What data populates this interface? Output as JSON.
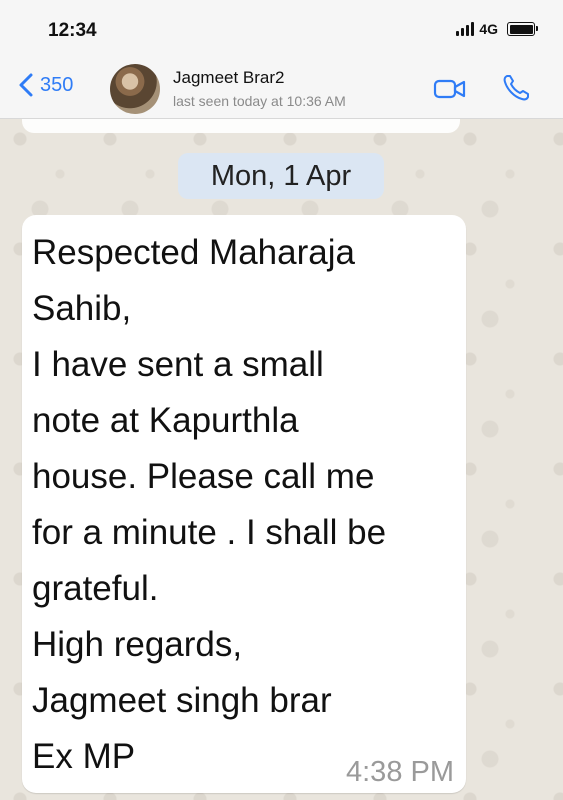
{
  "status_bar": {
    "time": "12:34",
    "network": "4G"
  },
  "header": {
    "back_count": "350",
    "contact_name": "Jagmeet Brar2",
    "last_seen": "last seen today at 10:36 AM"
  },
  "chat": {
    "date_label": "Mon, 1 Apr",
    "message": {
      "text": "Respected Maharaja\nSahib,\nI have sent a small\nnote at Kapurthla\nhouse. Please call me\nfor a minute . I shall be\ngrateful.\nHigh regards,\nJagmeet singh brar\nEx MP",
      "time": "4:38 PM"
    }
  },
  "colors": {
    "accent": "#2f7cf6",
    "date_pill": "#dbe6f3",
    "bubble": "#ffffff"
  },
  "icons": [
    "chevron-left-icon",
    "video-camera-icon",
    "phone-icon",
    "signal-icon",
    "battery-icon"
  ]
}
